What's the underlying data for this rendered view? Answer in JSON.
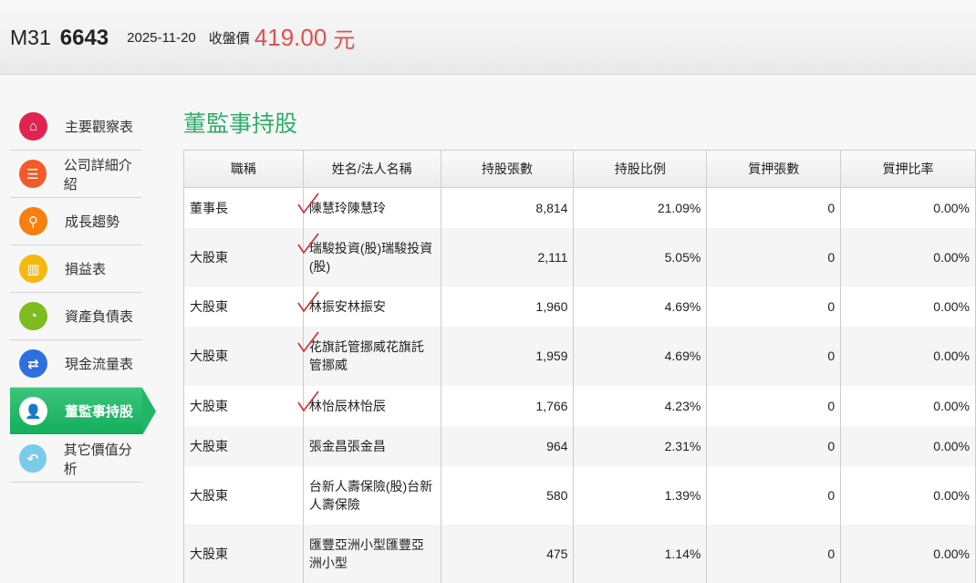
{
  "header": {
    "market": "M31",
    "code": "6643",
    "date": "2025-11-20",
    "price_label": "收盤價",
    "price": "419.00",
    "unit": "元"
  },
  "sidebar": {
    "items": [
      {
        "label": "主要觀察表",
        "icon": "home-icon",
        "color": "#e0234f",
        "glyph": "⌂"
      },
      {
        "label": "公司詳細介紹",
        "icon": "list-icon",
        "color": "#f25a2a",
        "glyph": "☰"
      },
      {
        "label": "成長趨勢",
        "icon": "search-icon",
        "color": "#f77f0e",
        "glyph": "⚲"
      },
      {
        "label": "損益表",
        "icon": "bar-chart-icon",
        "color": "#f4b90f",
        "glyph": "▥"
      },
      {
        "label": "資產負債表",
        "icon": "pie-chart-icon",
        "color": "#7dbb1e",
        "glyph": "◔"
      },
      {
        "label": "現金流量表",
        "icon": "transfer-icon",
        "color": "#2f6fe0",
        "glyph": "⇄"
      },
      {
        "label": "董監事持股",
        "icon": "user-icon",
        "color": "#ffffff",
        "glyph": "👤"
      },
      {
        "label": "其它價值分析",
        "icon": "reply-icon",
        "color": "#79cbea",
        "glyph": "↶"
      }
    ],
    "active": 6
  },
  "main": {
    "title": "董監事持股",
    "columns": [
      "職稱",
      "姓名/法人名稱",
      "持股張數",
      "持股比例",
      "質押張數",
      "質押比率"
    ],
    "rows": [
      [
        "董事長",
        "陳慧玲陳慧玲",
        "8,814",
        "21.09%",
        "0",
        "0.00%"
      ],
      [
        "大股東",
        "瑞駿投資(股)瑞駿投資(股)",
        "2,111",
        "5.05%",
        "0",
        "0.00%"
      ],
      [
        "大股東",
        "林振安林振安",
        "1,960",
        "4.69%",
        "0",
        "0.00%"
      ],
      [
        "大股東",
        "花旗託管挪威花旗託管挪威",
        "1,959",
        "4.69%",
        "0",
        "0.00%"
      ],
      [
        "大股東",
        "林怡辰林怡辰",
        "1,766",
        "4.23%",
        "0",
        "0.00%"
      ],
      [
        "大股東",
        "張金昌張金昌",
        "964",
        "2.31%",
        "0",
        "0.00%"
      ],
      [
        "大股東",
        "台新人壽保險(股)台新人壽保險",
        "580",
        "1.39%",
        "0",
        "0.00%"
      ],
      [
        "大股東",
        "匯豐亞洲小型匯豐亞洲小型",
        "475",
        "1.14%",
        "0",
        "0.00%"
      ]
    ],
    "checked_rows": [
      0,
      1,
      2,
      3,
      4
    ]
  }
}
